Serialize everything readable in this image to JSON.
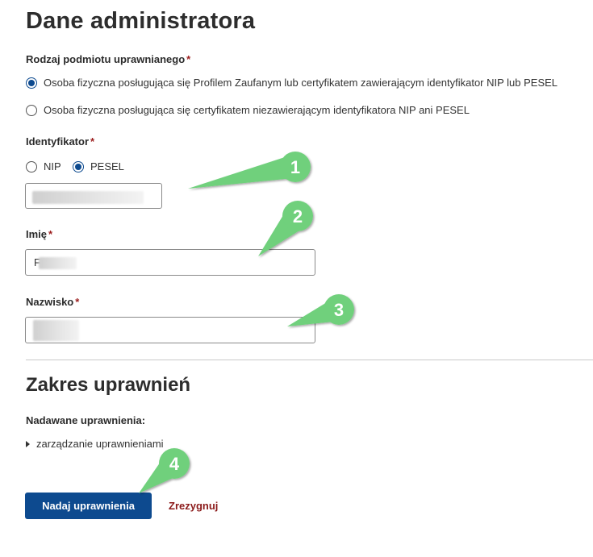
{
  "heading": "Dane administratora",
  "subject_type": {
    "label": "Rodzaj podmiotu uprawnianego",
    "required_mark": "*",
    "options": [
      {
        "label": "Osoba fizyczna posługująca się Profilem Zaufanym lub certyfikatem zawierającym identyfikator NIP lub PESEL",
        "checked": true
      },
      {
        "label": "Osoba fizyczna posługująca się certyfikatem niezawierającym identyfikatora NIP ani PESEL",
        "checked": false
      }
    ]
  },
  "identifier": {
    "label": "Identyfikator",
    "required_mark": "*",
    "options": [
      {
        "label": "NIP",
        "checked": false
      },
      {
        "label": "PESEL",
        "checked": true
      }
    ],
    "value": ""
  },
  "first_name": {
    "label": "Imię",
    "required_mark": "*",
    "value": "F"
  },
  "last_name": {
    "label": "Nazwisko",
    "required_mark": "*",
    "value": ""
  },
  "permissions_section": {
    "heading": "Zakres uprawnień",
    "label": "Nadawane uprawnienia:",
    "items": [
      "zarządzanie uprawnieniami"
    ]
  },
  "actions": {
    "submit": "Nadaj uprawnienia",
    "cancel": "Zrezygnuj"
  },
  "callouts": [
    "1",
    "2",
    "3",
    "4"
  ],
  "colors": {
    "primary": "#0d4a8f",
    "required": "#9b1c1c",
    "cancel": "#8b1a1a",
    "callout": "#66cc77"
  }
}
